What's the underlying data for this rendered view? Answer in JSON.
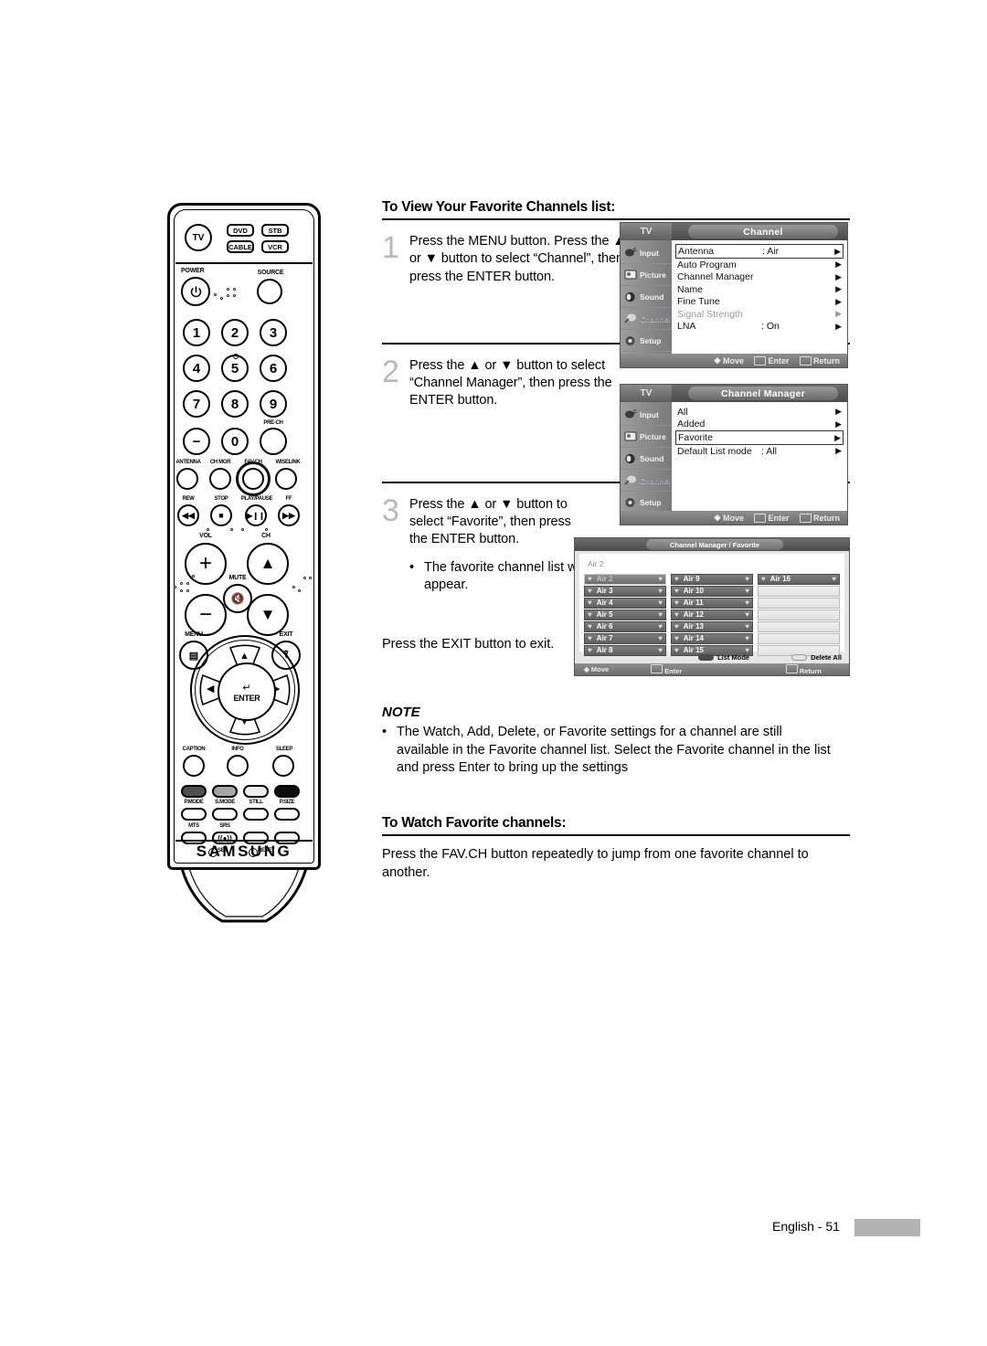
{
  "page": {
    "footer_text": "English - 51"
  },
  "sections": {
    "view_favorites": {
      "heading": "To View Your Favorite Channels list:",
      "steps": [
        {
          "num": "1",
          "text": "Press the MENU button. Press the ▲ or ▼ button to select “Channel”, then press the ENTER button."
        },
        {
          "num": "2",
          "text": "Press the ▲ or ▼ button to select “Channel Manager”, then press the ENTER button."
        },
        {
          "num": "3",
          "text": "Press the ▲ or ▼ button to select “Favorite”, then press the ENTER button."
        }
      ],
      "bullet": "The favorite channel list will appear.",
      "exit_note": "Press the EXIT button to exit."
    },
    "note": {
      "title": "NOTE",
      "bullet": "The Watch, Add, Delete, or Favorite settings for a channel are still available in the Favorite channel list. Select the Favorite channel in the list and press Enter to bring up the settings"
    },
    "watch_favorites": {
      "heading": "To Watch Favorite channels:",
      "body": "Press the FAV.CH button repeatedly to jump from one favorite channel to another."
    }
  },
  "osd_menus": [
    {
      "tv_label": "TV",
      "title": "Channel",
      "sidebar": [
        {
          "label": "Input",
          "icon": "input-icon",
          "selected": false
        },
        {
          "label": "Picture",
          "icon": "picture-icon",
          "selected": false
        },
        {
          "label": "Sound",
          "icon": "sound-icon",
          "selected": false
        },
        {
          "label": "Channel",
          "icon": "channel-icon",
          "selected": true
        },
        {
          "label": "Setup",
          "icon": "setup-icon",
          "selected": false
        }
      ],
      "rows": [
        {
          "name": "Antenna",
          "value": ": Air",
          "boxed": true,
          "dim": false
        },
        {
          "name": "Auto Program",
          "value": "",
          "boxed": false,
          "dim": false
        },
        {
          "name": "Channel Manager",
          "value": "",
          "boxed": false,
          "dim": false
        },
        {
          "name": "Name",
          "value": "",
          "boxed": false,
          "dim": false
        },
        {
          "name": "Fine Tune",
          "value": "",
          "boxed": false,
          "dim": false
        },
        {
          "name": "Signal Strength",
          "value": "",
          "boxed": false,
          "dim": true
        },
        {
          "name": "LNA",
          "value": ": On",
          "boxed": false,
          "dim": false
        }
      ],
      "hints": {
        "move": "Move",
        "enter": "Enter",
        "return": "Return"
      }
    },
    {
      "tv_label": "TV",
      "title": "Channel Manager",
      "sidebar": [
        {
          "label": "Input",
          "icon": "input-icon",
          "selected": false
        },
        {
          "label": "Picture",
          "icon": "picture-icon",
          "selected": false
        },
        {
          "label": "Sound",
          "icon": "sound-icon",
          "selected": false
        },
        {
          "label": "Channel",
          "icon": "channel-icon",
          "selected": true
        },
        {
          "label": "Setup",
          "icon": "setup-icon",
          "selected": false
        }
      ],
      "rows": [
        {
          "name": "All",
          "value": "",
          "boxed": false,
          "dim": false
        },
        {
          "name": "Added",
          "value": "",
          "boxed": false,
          "dim": false
        },
        {
          "name": "Favorite",
          "value": "",
          "boxed": true,
          "dim": false
        },
        {
          "name": "Default List mode",
          "value": ": All",
          "boxed": false,
          "dim": false
        }
      ],
      "hints": {
        "move": "Move",
        "enter": "Enter",
        "return": "Return"
      }
    }
  ],
  "channel_grid": {
    "title": "Channel Manager / Favorite",
    "current": "Air 2",
    "columns": [
      [
        "Air 2",
        "Air 3",
        "Air 4",
        "Air 5",
        "Air 6",
        "Air 7",
        "Air 8"
      ],
      [
        "Air 9",
        "Air 10",
        "Air 11",
        "Air 12",
        "Air 13",
        "Air 14",
        "Air 15"
      ],
      [
        "Air 16",
        "",
        "",
        "",
        "",
        "",
        ""
      ]
    ],
    "selected": "Air 2",
    "actions": {
      "list_mode": "List Mode",
      "delete_all": "Delete All"
    },
    "hints": {
      "move": "Move",
      "enter": "Enter",
      "return": "Return"
    }
  },
  "remote": {
    "brand": "SAMSUNG",
    "mode_buttons": [
      "TV",
      "DVD",
      "STB",
      "CABLE",
      "VCR"
    ],
    "power_label": "POWER",
    "source_label": "SOURCE",
    "keypad": [
      "1",
      "2",
      "3",
      "4",
      "5",
      "6",
      "7",
      "8",
      "9",
      "−",
      "0",
      ""
    ],
    "prech_label": "PRE-CH",
    "function_row": [
      "ANTENNA",
      "CH MGR",
      "FAV.CH",
      "WISELINK"
    ],
    "highlighted_button": "FAV.CH",
    "transport": [
      "REW",
      "STOP",
      "PLAY/PAUSE",
      "FF"
    ],
    "vol_label": "VOL",
    "ch_label": "CH",
    "mute_label": "MUTE",
    "menu_label": "MENU",
    "exit_label": "EXIT",
    "enter_label": "ENTER",
    "bottom_row1": [
      "CAPTION",
      "INFO",
      "SLEEP"
    ],
    "color_row": [
      "P.MODE",
      "S.MODE",
      "STILL",
      "P.SIZE"
    ],
    "bottom_row3": [
      "MTS",
      "SRS",
      "",
      ""
    ],
    "set_label": "SET",
    "reset_label": "RESET"
  }
}
